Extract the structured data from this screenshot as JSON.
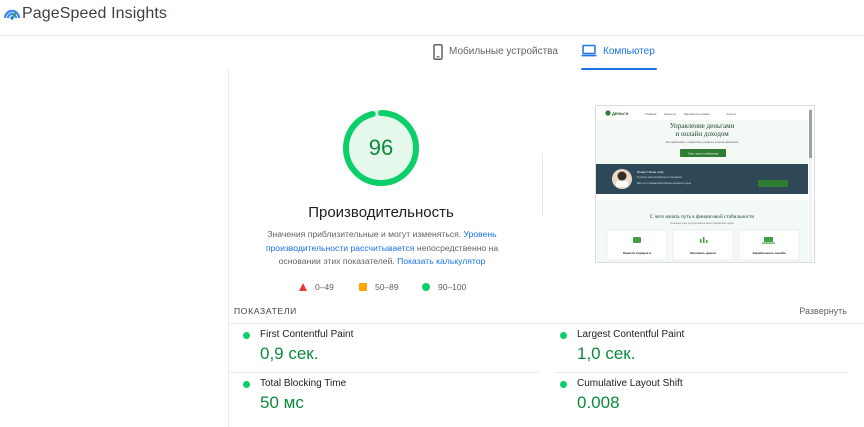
{
  "app": {
    "title": "PageSpeed Insights",
    "logo_icon": "pagespeed-logo-icon"
  },
  "tabs": [
    {
      "label": "Мобильные устройства",
      "icon": "smartphone-icon",
      "active": false
    },
    {
      "label": "Компьютер",
      "icon": "laptop-icon",
      "active": true
    }
  ],
  "performance": {
    "score": "96",
    "score_fraction": 0.96,
    "title": "Производительность",
    "desc_1": "Значения приблизительные и могут изменяться. ",
    "desc_link_1": "Уровень производительности рассчитывается",
    "desc_2": " непосредственно на основании этих показателей. ",
    "desc_link_2": "Показать калькулятор",
    "legend": [
      {
        "range": "0–49",
        "shape": "triangle",
        "color": "#e53935"
      },
      {
        "range": "50–89",
        "shape": "square",
        "color": "#ffa400"
      },
      {
        "range": "90–100",
        "shape": "circle",
        "color": "#0cce6b"
      }
    ]
  },
  "screenshot": {
    "logo": "money-icon",
    "brand": "ДЕНЬГИ",
    "nav": [
      "Главная",
      "Кредиты",
      "Заработок онлайн",
      "Статьи"
    ],
    "hero_line1": "Управление деньгами",
    "hero_line2": "и онлайн доходом",
    "hero_sub": "Как зарабатывать и эффективно управлять личными финансами",
    "hero_button": "Стать частью сообщества",
    "banner_title": "Привет! Меня зовут",
    "banner_text_1": "Я помогу вам разобраться в финансах",
    "banner_text_2": "Ваш путь к финансовой свободе начинается здесь",
    "section_title": "С чего начать путь к финансовой стабильности",
    "section_sub": "Основные шаги для достижения ваших финансовых целей",
    "cards": [
      {
        "label": "Навести порядок в",
        "icon": "wallet-icon"
      },
      {
        "label": "Заставить деньги",
        "icon": "chart-icon"
      },
      {
        "label": "Зарабатывать онлайн",
        "icon": "laptop-icon"
      }
    ]
  },
  "metrics_section": {
    "title": "ПОКАЗАТЕЛИ",
    "expand_label": "Развернуть"
  },
  "metrics": [
    {
      "label": "First Contentful Paint",
      "value": "0,9 сек.",
      "status": "pass"
    },
    {
      "label": "Largest Contentful Paint",
      "value": "1,0 сек.",
      "status": "pass"
    },
    {
      "label": "Total Blocking Time",
      "value": "50 мс",
      "status": "pass"
    },
    {
      "label": "Cumulative Layout Shift",
      "value": "0.008",
      "status": "pass"
    }
  ],
  "colors": {
    "accent": "#1a73e8",
    "pass": "#0cce6b",
    "pass_text": "#0c8a3c",
    "average": "#ffa400",
    "fail": "#e53935"
  }
}
